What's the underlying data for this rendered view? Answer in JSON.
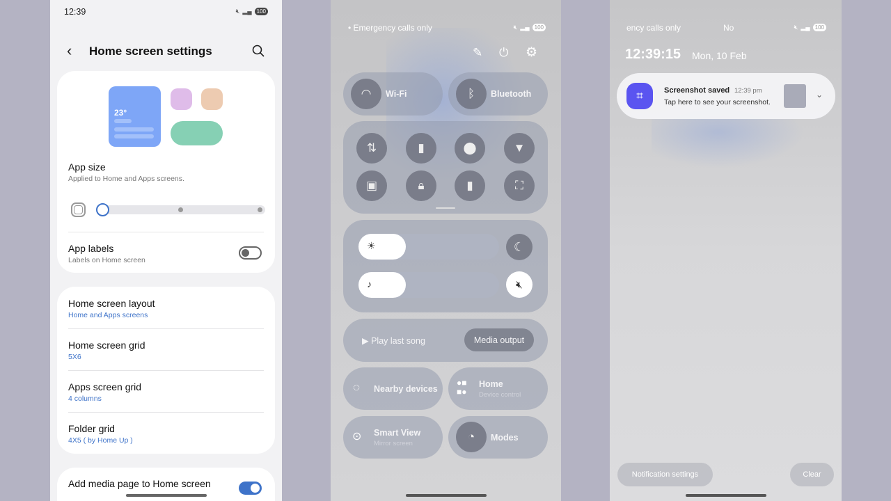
{
  "settings_screen": {
    "status": {
      "time": "12:39",
      "battery": "100"
    },
    "header": {
      "title": "Home screen settings",
      "back_icon": "chevron-left-icon",
      "search_icon": "search-icon"
    },
    "preview": {
      "weather_temp": "23°"
    },
    "app_size": {
      "label": "App size",
      "sub": "Applied to Home and Apps screens.",
      "slider_step": 1,
      "slider_steps": 3
    },
    "app_labels": {
      "label": "App labels",
      "sub": "Labels on Home screen",
      "enabled": false
    },
    "items": [
      {
        "label": "Home screen layout",
        "value": "Home and Apps screens"
      },
      {
        "label": "Home screen grid",
        "value": "5X6"
      },
      {
        "label": "Apps screen grid",
        "value": "4 columns"
      },
      {
        "label": "Folder grid",
        "value": "4X5 ( by Home Up )"
      }
    ],
    "media_page": {
      "label": "Add media page to Home screen",
      "enabled": true
    }
  },
  "quick_panel": {
    "status": {
      "carrier": "• Emergency calls only",
      "battery": "100"
    },
    "top_icons": [
      "edit-icon",
      "power-icon",
      "settings-icon"
    ],
    "wifi": "Wi-Fi",
    "bluetooth": "Bluetooth",
    "toggles": [
      "data-transfer-icon",
      "power-saving-icon",
      "location-icon",
      "flashlight-icon",
      "cast-icon",
      "secure-folder-icon",
      "battery-shield-icon",
      "screen-record-icon"
    ],
    "brightness_percent": 20,
    "volume_percent": 20,
    "media": {
      "play": "Play last song",
      "output": "Media output"
    },
    "nearby": "Nearby devices",
    "home": {
      "label": "Home",
      "sub": "Device control"
    },
    "smart_view": {
      "label": "Smart View",
      "sub": "Mirror screen"
    },
    "modes": "Modes"
  },
  "notifications": {
    "status": {
      "carrier": "ency calls only",
      "mid": "No",
      "battery": "100"
    },
    "clock": "12:39:15",
    "date": "Mon, 10 Feb",
    "notification": {
      "title": "Screenshot saved",
      "time": "12:39 pm",
      "body": "Tap here to see your screenshot."
    },
    "settings_button": "Notification settings",
    "clear_button": "Clear"
  },
  "colors": {
    "accent": "#3e73c9",
    "screenshot_app": "#5a54f0"
  }
}
